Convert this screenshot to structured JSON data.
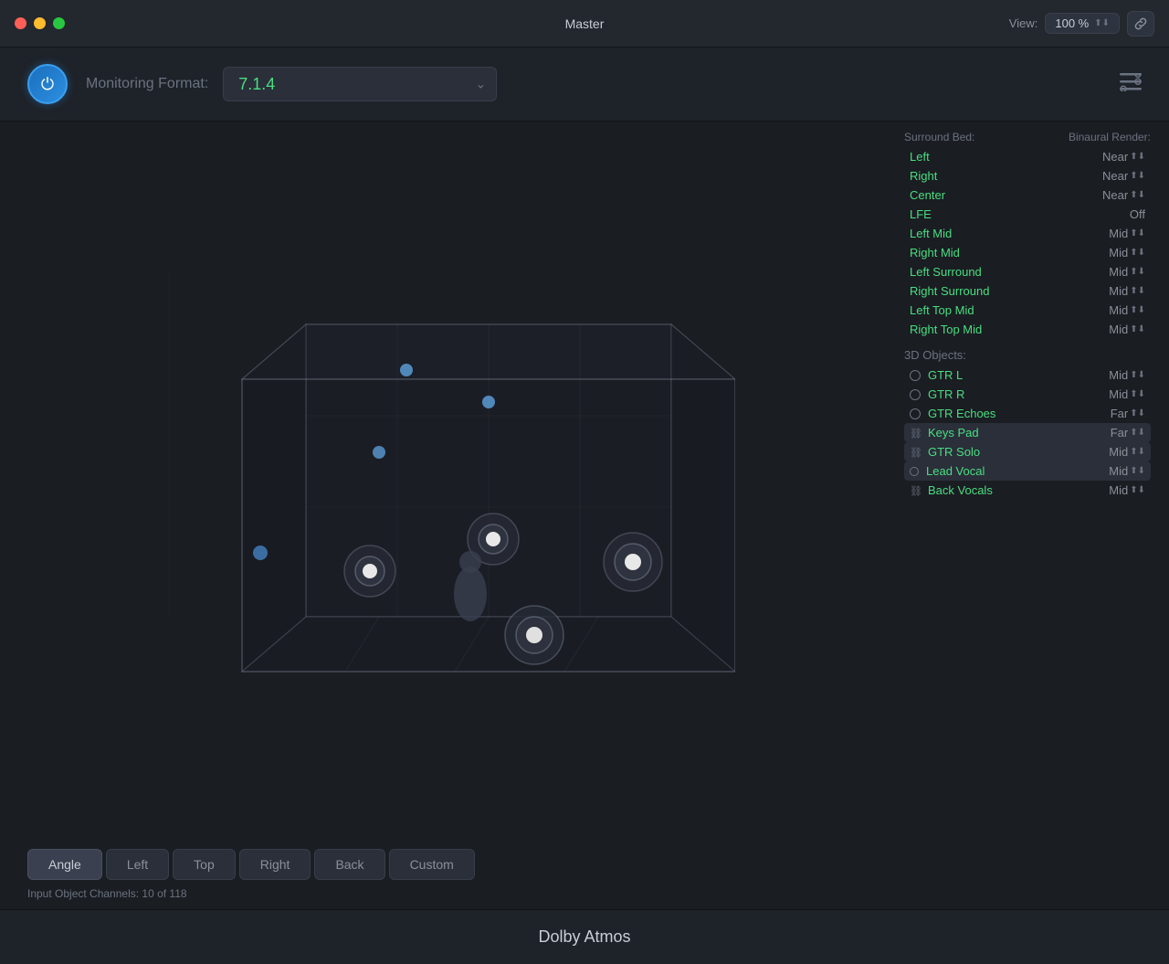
{
  "titleBar": {
    "title": "Master",
    "view_label": "View:",
    "view_value": "100 %"
  },
  "topSection": {
    "monitoring_label": "Monitoring Format:",
    "monitoring_value": "7.1.4"
  },
  "viewButtons": [
    {
      "id": "angle",
      "label": "Angle",
      "active": true
    },
    {
      "id": "left",
      "label": "Left",
      "active": false
    },
    {
      "id": "top",
      "label": "Top",
      "active": false
    },
    {
      "id": "right",
      "label": "Right",
      "active": false
    },
    {
      "id": "back",
      "label": "Back",
      "active": false
    },
    {
      "id": "custom",
      "label": "Custom",
      "active": false
    }
  ],
  "panel": {
    "surround_bed_label": "Surround Bed:",
    "binaural_render_label": "Binaural Render:",
    "surround_channels": [
      {
        "name": "Left",
        "value": "Near",
        "has_stepper": true
      },
      {
        "name": "Right",
        "value": "Near",
        "has_stepper": true
      },
      {
        "name": "Center",
        "value": "Near",
        "has_stepper": true
      },
      {
        "name": "LFE",
        "value": "Off",
        "has_stepper": false
      },
      {
        "name": "Left Mid",
        "value": "Mid",
        "has_stepper": true
      },
      {
        "name": "Right Mid",
        "value": "Mid",
        "has_stepper": true
      },
      {
        "name": "Left Surround",
        "value": "Mid",
        "has_stepper": true
      },
      {
        "name": "Right Surround",
        "value": "Mid",
        "has_stepper": true
      },
      {
        "name": "Left Top Mid",
        "value": "Mid",
        "has_stepper": true
      },
      {
        "name": "Right Top Mid",
        "value": "Mid",
        "has_stepper": true
      }
    ],
    "objects_label": "3D Objects:",
    "objects": [
      {
        "name": "GTR L",
        "value": "Mid",
        "has_stepper": true,
        "indicator": "circle",
        "highlighted": false
      },
      {
        "name": "GTR R",
        "value": "Mid",
        "has_stepper": true,
        "indicator": "circle",
        "highlighted": false
      },
      {
        "name": "GTR Echoes",
        "value": "Far",
        "has_stepper": true,
        "indicator": "circle",
        "highlighted": false
      },
      {
        "name": "Keys Pad",
        "value": "Far",
        "has_stepper": true,
        "indicator": "chain",
        "highlighted": true
      },
      {
        "name": "GTR Solo",
        "value": "Mid",
        "has_stepper": true,
        "indicator": "chain",
        "highlighted": true
      },
      {
        "name": "Lead Vocal",
        "value": "Mid",
        "has_stepper": true,
        "indicator": "circle-small",
        "highlighted": true
      },
      {
        "name": "Back Vocals",
        "value": "Mid",
        "has_stepper": true,
        "indicator": "chain",
        "highlighted": false
      }
    ],
    "input_channels_label": "Input Object Channels: 10 of 118"
  },
  "bottomBar": {
    "title": "Dolby Atmos"
  }
}
